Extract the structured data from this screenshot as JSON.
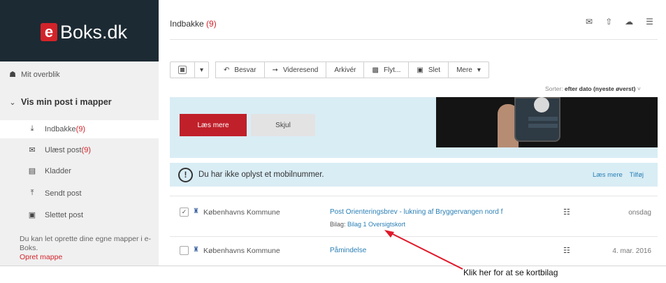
{
  "app": {
    "logo_letter": "e",
    "logo_text": "Boks.dk",
    "brand_color": "#d2232a",
    "header_bg": "#1c2a33"
  },
  "sidebar": {
    "overview": "Mit overblik",
    "section": "Vis min post i mapper",
    "items": [
      {
        "label": "Indbakke",
        "count": "(9)",
        "icon": "inbox-icon"
      },
      {
        "label": "Ulæst post",
        "count": "(9)",
        "icon": "envelope-icon"
      },
      {
        "label": "Kladder",
        "count": "",
        "icon": "document-icon"
      },
      {
        "label": "Sendt post",
        "count": "",
        "icon": "outbox-icon"
      },
      {
        "label": "Slettet post",
        "count": "",
        "icon": "trash-icon"
      }
    ],
    "info": "Du kan let oprette dine egne mapper i e-Boks.",
    "info_link": "Opret mappe"
  },
  "main": {
    "title": "Indbakke",
    "title_count": "(9)",
    "toolbar": {
      "select_all": "",
      "reply": "Besvar",
      "forward": "Videresend",
      "archive": "Arkivér",
      "move": "Flyt...",
      "delete": "Slet",
      "more": "Mere"
    },
    "sort_prefix": "Sorter:",
    "sort_value": "efter dato (nyeste øverst)",
    "banner": {
      "read_more": "Læs mere",
      "hide": "Skjul"
    },
    "info_bar": {
      "text": "Du har ikke oplyst et mobilnummer.",
      "read_more": "Læs mere",
      "add": "Tilføj"
    },
    "messages": [
      {
        "checked": true,
        "sender": "Københavns Kommune",
        "subject": "Post Orienteringsbrev - lukning af Bryggervangen nord f",
        "attachments_label": "Bilag:",
        "attachment": "Bilag 1 Oversigtskort",
        "date": "onsdag"
      },
      {
        "checked": false,
        "sender": "Københavns Kommune",
        "subject": "Påmindelse",
        "attachments_label": "",
        "attachment": "",
        "date": "4. mar. 2016"
      }
    ]
  },
  "annotation": {
    "text": "Klik her for at se kortbilag",
    "color": "#e0192a"
  }
}
